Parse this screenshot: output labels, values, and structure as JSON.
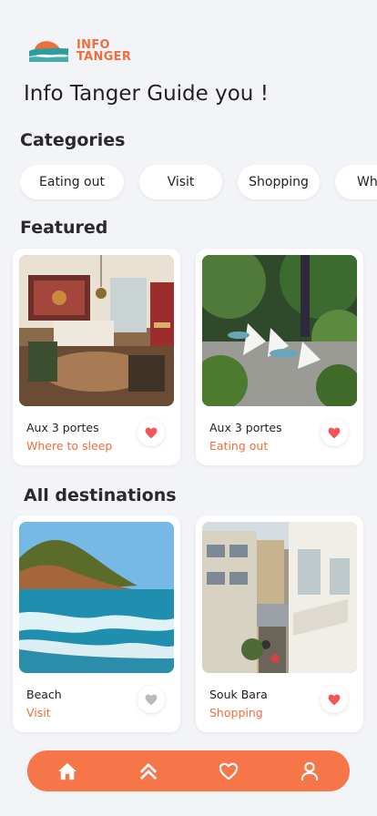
{
  "logo": {
    "line1": "INFO",
    "line2": "TANGER"
  },
  "tagline": "Info Tanger Guide you !",
  "categories": {
    "title": "Categories",
    "items": [
      "Eating out",
      "Visit",
      "Shopping",
      "Wh"
    ]
  },
  "featured": {
    "title": "Featured",
    "cards": [
      {
        "title": "Aux 3 portes",
        "subtitle": "Where to sleep",
        "favorite": true
      },
      {
        "title": "Aux 3 portes",
        "subtitle": "Eating out",
        "favorite": true
      }
    ]
  },
  "destinations": {
    "title": "All destinations",
    "cards": [
      {
        "title": "Beach",
        "subtitle": "Visit",
        "favorite": false
      },
      {
        "title": "Souk Bara",
        "subtitle": "Shopping",
        "favorite": true
      }
    ]
  },
  "nav": {
    "items": [
      "home-icon",
      "chevrons-up-icon",
      "heart-icon",
      "user-icon"
    ]
  },
  "colors": {
    "accent": "#f26d3d",
    "nav": "#f6764a",
    "favorite_on": "#f2555a",
    "favorite_off": "#b9b9b9"
  }
}
